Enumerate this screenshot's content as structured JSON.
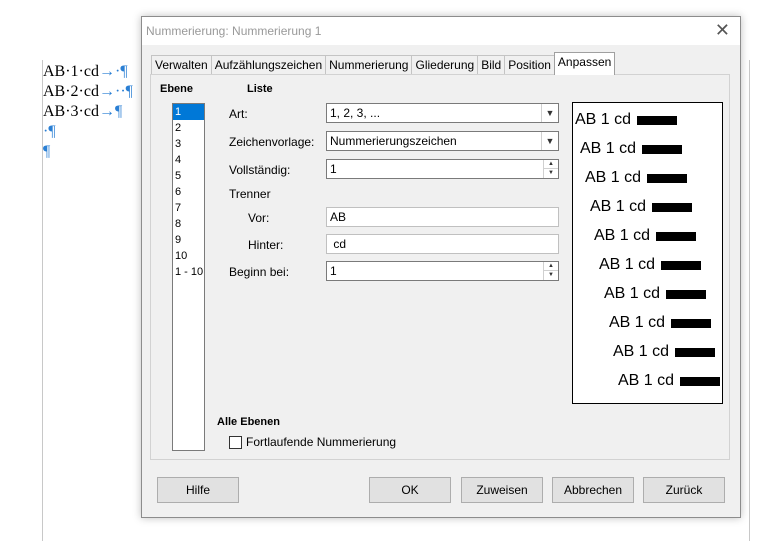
{
  "document": {
    "lines": [
      {
        "text": "AB·1·cd",
        "marks": "→·¶"
      },
      {
        "text": "AB·2·cd",
        "marks": "→··¶"
      },
      {
        "text": "AB·3·cd",
        "marks": "→¶"
      },
      {
        "text": "",
        "marks": "·¶"
      },
      {
        "text": "",
        "marks": "¶"
      }
    ]
  },
  "dialog": {
    "title": "Nummerierung: Nummerierung 1",
    "close_glyph": "✕",
    "tabs": [
      "Verwalten",
      "Aufzählungszeichen",
      "Nummerierung",
      "Gliederung",
      "Bild",
      "Position",
      "Anpassen"
    ],
    "active_tab": "Anpassen",
    "ebene_label": "Ebene",
    "levels": [
      "1",
      "2",
      "3",
      "4",
      "5",
      "6",
      "7",
      "8",
      "9",
      "10",
      "1 - 10"
    ],
    "selected_level": "1",
    "liste_label": "Liste",
    "art": {
      "label": "Art:",
      "value": "1, 2, 3, ..."
    },
    "zeichenvorlage": {
      "label": "Zeichenvorlage:",
      "value": "Nummerierungszeichen"
    },
    "vollstaendig": {
      "label": "Vollständig:",
      "value": "1"
    },
    "trenner_label": "Trenner",
    "vor": {
      "label": "Vor:",
      "value": "AB"
    },
    "hinter": {
      "label": "Hinter:",
      "value": " cd"
    },
    "beginn": {
      "label": "Beginn bei:",
      "value": "1"
    },
    "preview_text": "AB 1 cd",
    "alle_ebenen_label": "Alle Ebenen",
    "fortlaufend_label": "Fortlaufende Nummerierung",
    "buttons": {
      "hilfe": "Hilfe",
      "ok": "OK",
      "zuweisen": "Zuweisen",
      "abbrechen": "Abbrechen",
      "zurueck": "Zurück"
    }
  },
  "colors": {
    "selection": "#0078d7",
    "formatting_marks": "#2a7fd4"
  }
}
